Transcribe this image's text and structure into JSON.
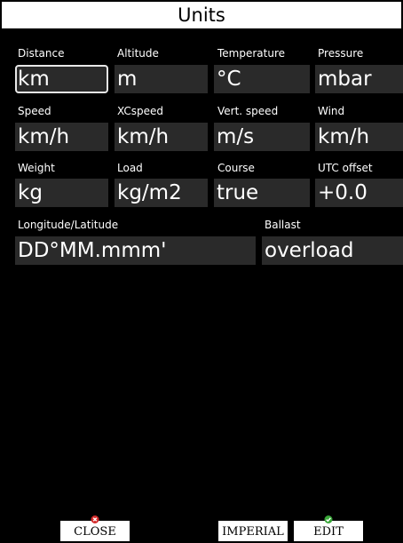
{
  "title": "Units",
  "fields": {
    "distance": {
      "label": "Distance",
      "value": "km"
    },
    "altitude": {
      "label": "Altitude",
      "value": "m"
    },
    "temperature": {
      "label": "Temperature",
      "value": "°C"
    },
    "pressure": {
      "label": "Pressure",
      "value": "mbar"
    },
    "speed": {
      "label": "Speed",
      "value": "km/h"
    },
    "xcspeed": {
      "label": "XCspeed",
      "value": "km/h"
    },
    "vertspeed": {
      "label": "Vert. speed",
      "value": "m/s"
    },
    "wind": {
      "label": "Wind",
      "value": "km/h"
    },
    "weight": {
      "label": "Weight",
      "value": "kg"
    },
    "load": {
      "label": "Load",
      "value": "kg/m2"
    },
    "course": {
      "label": "Course",
      "value": "true"
    },
    "utc_offset": {
      "label": "UTC offset",
      "value": "+0.0"
    },
    "longlat": {
      "label": "Longitude/Latitude",
      "value": "DD°MM.mmm'"
    },
    "ballast": {
      "label": "Ballast",
      "value": "overload"
    }
  },
  "buttons": {
    "close": {
      "label": "CLOSE",
      "icon": "close-icon"
    },
    "imperial": {
      "label": "IMPERIAL"
    },
    "edit": {
      "label": "EDIT",
      "icon": "checkmark-icon"
    }
  },
  "colors": {
    "close_icon": "#d42b2b",
    "edit_icon": "#3aa83a"
  }
}
